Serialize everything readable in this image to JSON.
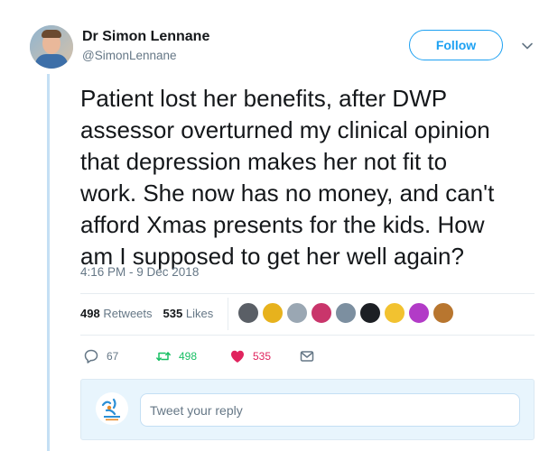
{
  "author": {
    "name": "Dr Simon Lennane",
    "handle": "@SimonLennane"
  },
  "follow_label": "Follow",
  "tweet": {
    "lines": [
      "Patient lost her benefits, after DWP",
      "assessor overturned my clinical opinion",
      "that depression makes her not fit to",
      "work. She now has no money, and can't",
      "afford Xmas presents for the kids. How",
      "am I supposed to get her well again?"
    ],
    "timestamp": "4:16 PM - 9 Dec 2018"
  },
  "stats": {
    "retweets_count": "498",
    "retweets_label": "Retweets",
    "likes_count": "535",
    "likes_label": "Likes"
  },
  "likers": [
    {
      "icon": "avatar-1",
      "color": "#5a5f66"
    },
    {
      "icon": "avatar-2",
      "color": "#e7b21d"
    },
    {
      "icon": "avatar-3",
      "color": "#9aa7b3"
    },
    {
      "icon": "avatar-4",
      "color": "#c9356b"
    },
    {
      "icon": "avatar-5",
      "color": "#7c8fa0"
    },
    {
      "icon": "avatar-6",
      "color": "#1c1f24"
    },
    {
      "icon": "avatar-7",
      "color": "#f2c230"
    },
    {
      "icon": "avatar-8",
      "color": "#b23bc7"
    },
    {
      "icon": "avatar-9",
      "color": "#b8762f"
    }
  ],
  "actions": {
    "reply_count": "67",
    "retweet_count": "498",
    "like_count": "535"
  },
  "reply": {
    "placeholder": "Tweet your reply"
  },
  "colors": {
    "accent": "#1da1f2",
    "retweet": "#17bf63",
    "like": "#e0245e",
    "muted": "#657786"
  }
}
